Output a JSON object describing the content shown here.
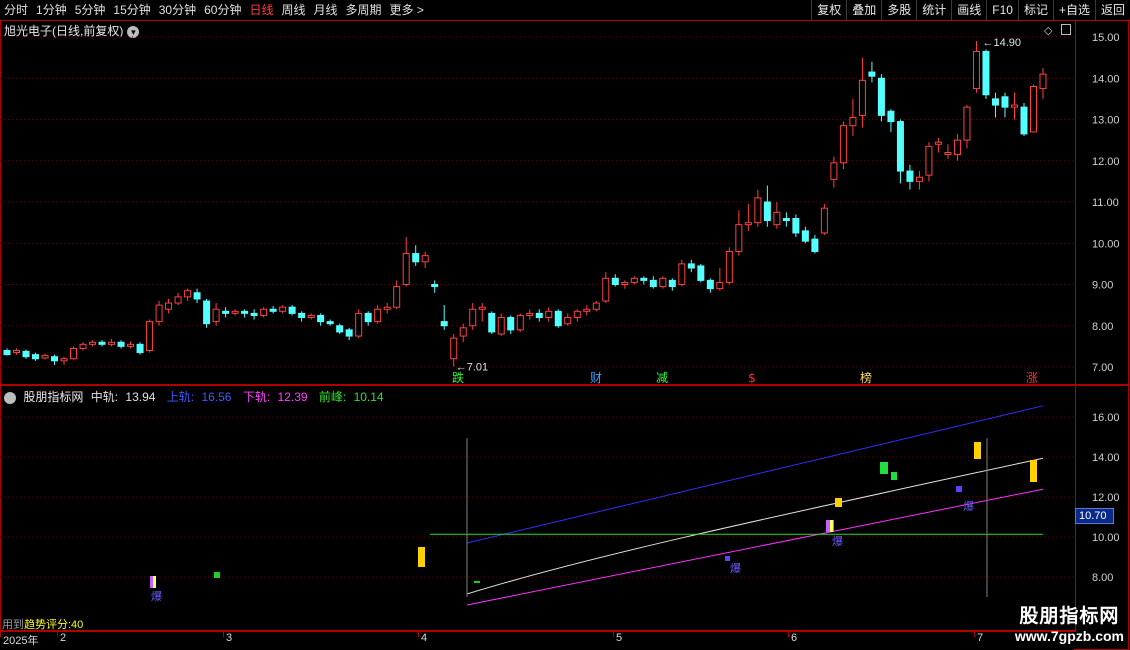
{
  "toolbar": {
    "periods": [
      "分时",
      "1分钟",
      "5分钟",
      "15分钟",
      "30分钟",
      "60分钟",
      "日线",
      "周线",
      "月线",
      "多周期",
      "更多 >"
    ],
    "active_index": 6,
    "buttons": [
      "复权",
      "叠加",
      "多股",
      "统计",
      "画线",
      "F10",
      "标记",
      "+自选",
      "返回"
    ]
  },
  "main_panel": {
    "title": "旭光电子(日线,前复权)",
    "y_ticks": [
      "15.00",
      "14.00",
      "13.00",
      "12.00",
      "11.00",
      "10.00",
      "9.00",
      "8.00",
      "7.00"
    ],
    "high_label": "14.90",
    "low_label": "7.01",
    "events": [
      {
        "label": "跌",
        "color": "#30ff30"
      },
      {
        "label": "财",
        "color": "#3aa0ff"
      },
      {
        "label": "减",
        "color": "#30ff30"
      },
      {
        "label": "$",
        "color": "#ff3030"
      },
      {
        "label": "榜",
        "color": "#ffdd66"
      },
      {
        "label": "涨",
        "color": "#ff3030"
      }
    ]
  },
  "indicator": {
    "name": "股朋指标网",
    "mid_label": "中轨:",
    "mid_value": "13.94",
    "upper_label": "上轨:",
    "upper_value": "16.56",
    "lower_label": "下轨:",
    "lower_value": "12.39",
    "peak_label": "前峰:",
    "peak_value": "10.14",
    "y_ticks": [
      "16.00",
      "14.00",
      "12.00",
      "10.00",
      "8.00"
    ],
    "current_value": "10.70",
    "score_prefix": "用到",
    "score_text": "趋势评分:40",
    "bao_label": "爆"
  },
  "date_axis": [
    "2025年",
    "2",
    "3",
    "4",
    "5",
    "6",
    "7"
  ],
  "watermark": {
    "name": "股朋指标网",
    "url": "www.7gpzb.com"
  },
  "colors": {
    "up": "#ff4040",
    "down": "#54ffff",
    "upper": "#3030ff",
    "lower": "#ff30ff",
    "mid": "#e0e0e0",
    "peak": "#20e020",
    "frame": "#b00000"
  },
  "chart_data": {
    "type": "candlestick",
    "price_range": [
      6.6,
      15.5
    ],
    "candles": [
      [
        7.4,
        7.3,
        7.45,
        7.28
      ],
      [
        7.35,
        7.4,
        7.45,
        7.3
      ],
      [
        7.38,
        7.25,
        7.42,
        7.2
      ],
      [
        7.3,
        7.2,
        7.35,
        7.15
      ],
      [
        7.22,
        7.28,
        7.32,
        7.18
      ],
      [
        7.25,
        7.15,
        7.3,
        7.05
      ],
      [
        7.15,
        7.2,
        7.25,
        7.05
      ],
      [
        7.2,
        7.45,
        7.5,
        7.18
      ],
      [
        7.45,
        7.55,
        7.6,
        7.4
      ],
      [
        7.55,
        7.6,
        7.65,
        7.5
      ],
      [
        7.6,
        7.55,
        7.65,
        7.5
      ],
      [
        7.55,
        7.6,
        7.68,
        7.5
      ],
      [
        7.6,
        7.5,
        7.65,
        7.45
      ],
      [
        7.5,
        7.55,
        7.62,
        7.45
      ],
      [
        7.55,
        7.35,
        7.6,
        7.3
      ],
      [
        7.4,
        8.1,
        8.15,
        7.35
      ],
      [
        8.1,
        8.5,
        8.6,
        8.0
      ],
      [
        8.4,
        8.55,
        8.65,
        8.3
      ],
      [
        8.55,
        8.7,
        8.8,
        8.5
      ],
      [
        8.7,
        8.85,
        8.9,
        8.6
      ],
      [
        8.8,
        8.65,
        8.9,
        8.55
      ],
      [
        8.6,
        8.05,
        8.65,
        7.95
      ],
      [
        8.1,
        8.4,
        8.55,
        8.0
      ],
      [
        8.35,
        8.3,
        8.45,
        8.2
      ],
      [
        8.3,
        8.35,
        8.4,
        8.25
      ],
      [
        8.35,
        8.3,
        8.4,
        8.2
      ],
      [
        8.3,
        8.25,
        8.4,
        8.15
      ],
      [
        8.25,
        8.4,
        8.45,
        8.2
      ],
      [
        8.4,
        8.35,
        8.48,
        8.3
      ],
      [
        8.35,
        8.45,
        8.5,
        8.3
      ],
      [
        8.45,
        8.3,
        8.5,
        8.25
      ],
      [
        8.3,
        8.2,
        8.35,
        8.1
      ],
      [
        8.2,
        8.25,
        8.3,
        8.15
      ],
      [
        8.25,
        8.1,
        8.3,
        8.0
      ],
      [
        8.1,
        8.05,
        8.15,
        8.0
      ],
      [
        8.0,
        7.85,
        8.05,
        7.8
      ],
      [
        7.9,
        7.75,
        7.95,
        7.65
      ],
      [
        7.75,
        8.3,
        8.4,
        7.7
      ],
      [
        8.3,
        8.1,
        8.35,
        8.0
      ],
      [
        8.1,
        8.4,
        8.5,
        8.05
      ],
      [
        8.4,
        8.45,
        8.55,
        8.3
      ],
      [
        8.45,
        8.95,
        9.1,
        8.4
      ],
      [
        9.0,
        9.75,
        10.15,
        8.95
      ],
      [
        9.75,
        9.55,
        9.95,
        9.45
      ],
      [
        9.55,
        9.7,
        9.8,
        9.4
      ],
      [
        9.0,
        8.95,
        9.1,
        8.8
      ],
      [
        8.1,
        8.0,
        8.5,
        7.9
      ],
      [
        7.2,
        7.7,
        7.8,
        7.01
      ],
      [
        7.75,
        7.95,
        8.05,
        7.6
      ],
      [
        8.0,
        8.4,
        8.55,
        7.9
      ],
      [
        8.4,
        8.45,
        8.55,
        8.1
      ],
      [
        8.3,
        7.85,
        8.35,
        7.8
      ],
      [
        7.8,
        8.2,
        8.3,
        7.75
      ],
      [
        8.2,
        7.9,
        8.25,
        7.8
      ],
      [
        7.9,
        8.25,
        8.3,
        7.85
      ],
      [
        8.25,
        8.3,
        8.4,
        8.15
      ],
      [
        8.3,
        8.2,
        8.4,
        8.1
      ],
      [
        8.2,
        8.35,
        8.45,
        8.1
      ],
      [
        8.35,
        8.0,
        8.4,
        7.95
      ],
      [
        8.05,
        8.2,
        8.3,
        8.0
      ],
      [
        8.2,
        8.35,
        8.4,
        8.1
      ],
      [
        8.35,
        8.4,
        8.5,
        8.25
      ],
      [
        8.4,
        8.55,
        8.6,
        8.35
      ],
      [
        8.6,
        9.15,
        9.3,
        8.55
      ],
      [
        9.15,
        9.0,
        9.25,
        8.95
      ],
      [
        9.0,
        9.05,
        9.1,
        8.9
      ],
      [
        9.05,
        9.15,
        9.2,
        9.0
      ],
      [
        9.15,
        9.1,
        9.2,
        9.0
      ],
      [
        9.1,
        8.95,
        9.2,
        8.9
      ],
      [
        8.95,
        9.15,
        9.2,
        8.9
      ],
      [
        9.1,
        8.95,
        9.15,
        8.85
      ],
      [
        9.0,
        9.5,
        9.6,
        8.95
      ],
      [
        9.5,
        9.4,
        9.6,
        9.3
      ],
      [
        9.45,
        9.1,
        9.5,
        9.05
      ],
      [
        9.1,
        8.9,
        9.15,
        8.8
      ],
      [
        8.9,
        9.05,
        9.4,
        8.85
      ],
      [
        9.05,
        9.8,
        9.9,
        9.0
      ],
      [
        9.8,
        10.45,
        10.8,
        9.7
      ],
      [
        10.45,
        10.5,
        10.95,
        10.3
      ],
      [
        10.5,
        11.1,
        11.3,
        10.4
      ],
      [
        11.0,
        10.55,
        11.4,
        10.4
      ],
      [
        10.45,
        10.75,
        11.0,
        10.35
      ],
      [
        10.6,
        10.55,
        10.75,
        10.4
      ],
      [
        10.6,
        10.25,
        10.7,
        10.15
      ],
      [
        10.3,
        10.05,
        10.4,
        10.0
      ],
      [
        10.1,
        9.8,
        10.2,
        9.75
      ],
      [
        10.25,
        10.85,
        10.95,
        10.2
      ],
      [
        11.55,
        11.95,
        12.1,
        11.35
      ],
      [
        11.95,
        12.85,
        12.95,
        11.8
      ],
      [
        12.85,
        13.05,
        13.5,
        12.6
      ],
      [
        13.1,
        13.95,
        14.5,
        12.8
      ],
      [
        14.15,
        14.05,
        14.4,
        13.9
      ],
      [
        14.0,
        13.1,
        14.1,
        12.95
      ],
      [
        13.2,
        12.95,
        13.25,
        12.7
      ],
      [
        12.95,
        11.75,
        13.0,
        11.45
      ],
      [
        11.75,
        11.5,
        11.9,
        11.3
      ],
      [
        11.5,
        11.6,
        11.75,
        11.3
      ],
      [
        11.65,
        12.35,
        12.45,
        11.5
      ],
      [
        12.4,
        12.45,
        12.55,
        12.2
      ],
      [
        12.15,
        12.2,
        12.4,
        12.05
      ],
      [
        12.15,
        12.5,
        12.65,
        12.0
      ],
      [
        12.5,
        13.3,
        13.35,
        12.3
      ],
      [
        13.75,
        14.65,
        14.9,
        13.65
      ],
      [
        14.65,
        13.6,
        14.7,
        13.5
      ],
      [
        13.5,
        13.35,
        13.65,
        13.05
      ],
      [
        13.55,
        13.3,
        13.65,
        13.05
      ],
      [
        13.3,
        13.35,
        13.65,
        13.0
      ],
      [
        13.3,
        12.65,
        13.4,
        12.6
      ],
      [
        12.7,
        13.8,
        13.85,
        12.7
      ],
      [
        13.75,
        14.1,
        14.25,
        13.5
      ]
    ],
    "indicator_range": [
      7.0,
      17.0
    ],
    "upper_band": [
      [
        13.0,
        0
      ],
      [
        113.0,
        16.56
      ]
    ],
    "lower_band": [
      [
        13.0,
        0
      ],
      [
        113.0,
        12.39
      ]
    ],
    "mid_line": [
      [
        13.0,
        0
      ],
      [
        113.0,
        13.94
      ]
    ],
    "peak_line": 10.14
  }
}
